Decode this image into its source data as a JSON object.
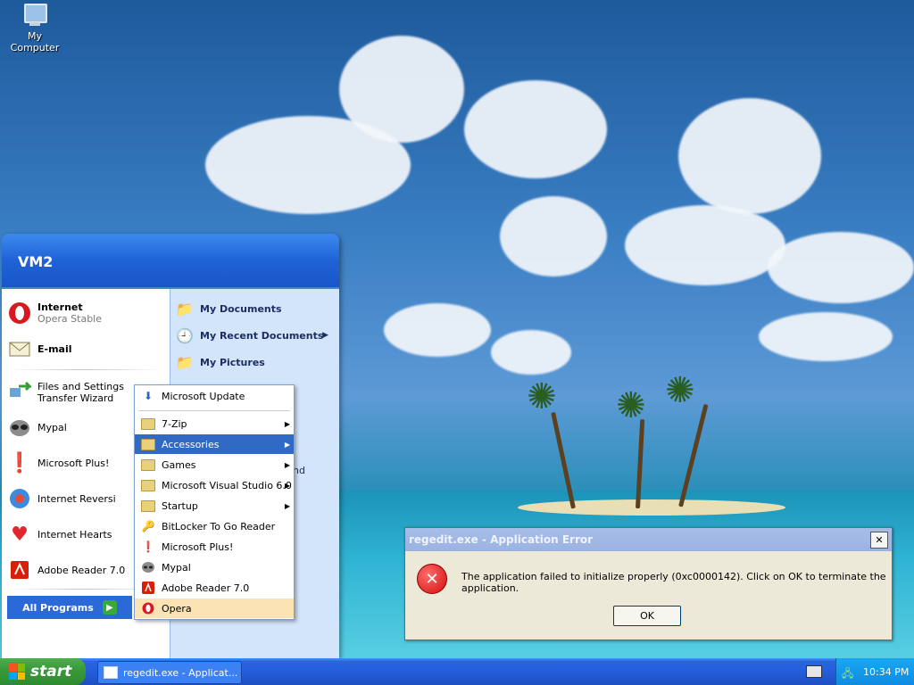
{
  "desktop": {
    "icons": [
      {
        "label": "My Computer",
        "icon": "my-computer-icon"
      }
    ]
  },
  "start_menu": {
    "user": "VM2",
    "pinned": [
      {
        "title": "Internet",
        "subtitle": "Opera Stable",
        "icon": "opera-icon"
      },
      {
        "title": "E-mail",
        "subtitle": "",
        "icon": "email-icon"
      }
    ],
    "recent": [
      {
        "label": "Files and Settings Transfer Wizard",
        "icon": "transfer-wizard-icon"
      },
      {
        "label": "Mypal",
        "icon": "mypal-icon"
      },
      {
        "label": "Microsoft Plus!",
        "icon": "microsoft-plus-icon"
      },
      {
        "label": "Internet Reversi",
        "icon": "internet-reversi-icon"
      },
      {
        "label": "Internet Hearts",
        "icon": "internet-hearts-icon"
      },
      {
        "label": "Adobe Reader 7.0",
        "icon": "adobe-reader-icon"
      }
    ],
    "all_programs": "All Programs",
    "right": [
      {
        "label": "My Documents",
        "icon": "folder-icon"
      },
      {
        "label": "My Recent Documents",
        "icon": "recent-docs-icon"
      },
      {
        "label": "My Pictures",
        "icon": "folder-icon"
      }
    ],
    "partial_text": "nd"
  },
  "programs_submenu": {
    "items": [
      {
        "label": "Microsoft Update",
        "icon": "windows-update-icon",
        "arrow": false
      },
      {
        "label": "7-Zip",
        "icon": "folder-icon",
        "arrow": true
      },
      {
        "label": "Accessories",
        "icon": "folder-icon",
        "arrow": true
      },
      {
        "label": "Games",
        "icon": "folder-icon",
        "arrow": true
      },
      {
        "label": "Microsoft Visual Studio 6.0",
        "icon": "folder-icon",
        "arrow": true
      },
      {
        "label": "Startup",
        "icon": "folder-icon",
        "arrow": true
      },
      {
        "label": "BitLocker To Go Reader",
        "icon": "bitlocker-icon",
        "arrow": false
      },
      {
        "label": "Microsoft Plus!",
        "icon": "microsoft-plus-icon",
        "arrow": false
      },
      {
        "label": "Mypal",
        "icon": "mypal-icon",
        "arrow": false
      },
      {
        "label": "Adobe Reader 7.0",
        "icon": "adobe-reader-icon",
        "arrow": false
      },
      {
        "label": "Opera",
        "icon": "opera-icon",
        "arrow": false
      }
    ]
  },
  "dialog": {
    "title": "regedit.exe - Application Error",
    "close_glyph": "✕",
    "icon_glyph": "✕",
    "message": "The application failed to initialize properly (0xc0000142). Click on OK to terminate the application.",
    "ok_label": "OK"
  },
  "taskbar": {
    "start_label": "start",
    "buttons": [
      {
        "label": "regedit.exe - Applicat..."
      }
    ],
    "clock": "10:34 PM"
  },
  "colors": {
    "taskbar_blue": "#245edb",
    "start_green": "#3a9b3a",
    "menu_highlight": "#316ac5",
    "hover_highlight": "#fbe3b3"
  }
}
